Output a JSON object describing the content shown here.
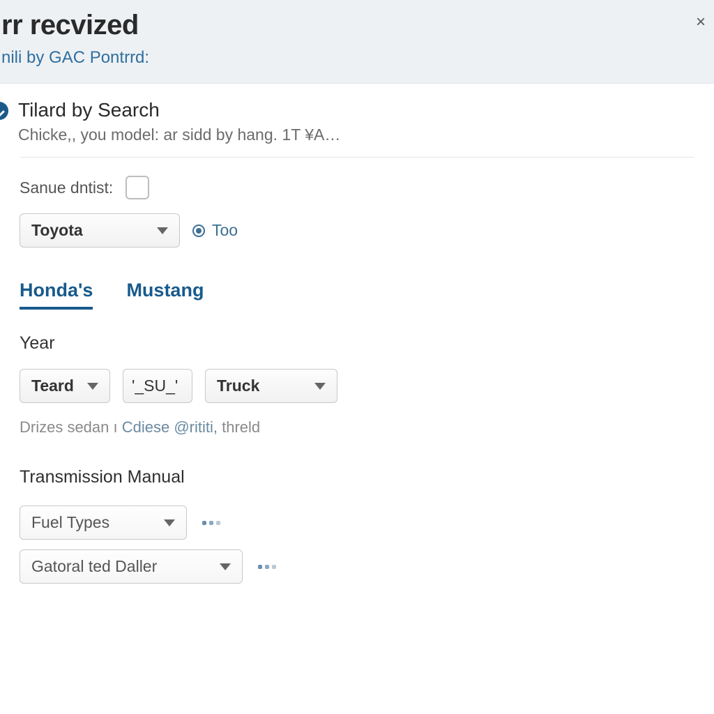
{
  "header": {
    "title": "rr recvized",
    "subtitle": "nili by GAC Pontrrd:"
  },
  "search_section": {
    "title": "Tilard by Search",
    "description": "Chicke,, you model: ar sidd by hang. 1T ¥A…",
    "save_label": "Sanue dntist:"
  },
  "make": {
    "selected": "Toyota",
    "radio_label": "Too"
  },
  "tabs": [
    {
      "label": "Honda's",
      "active": true
    },
    {
      "label": "Mustang",
      "active": false
    }
  ],
  "year": {
    "label": "Year",
    "dd1": "Teard",
    "dd2": "'_SU_'",
    "dd3": "Truck"
  },
  "hint_text": {
    "pre": "Drizes sedan ı ",
    "link1": "Cdiese",
    "mid": " @rititi,",
    "post": " threld"
  },
  "transmission": {
    "label": "Transmission Manual"
  },
  "fuel": {
    "label": "Fuel Types"
  },
  "dealer": {
    "label": "Gatoral ted Daller"
  }
}
